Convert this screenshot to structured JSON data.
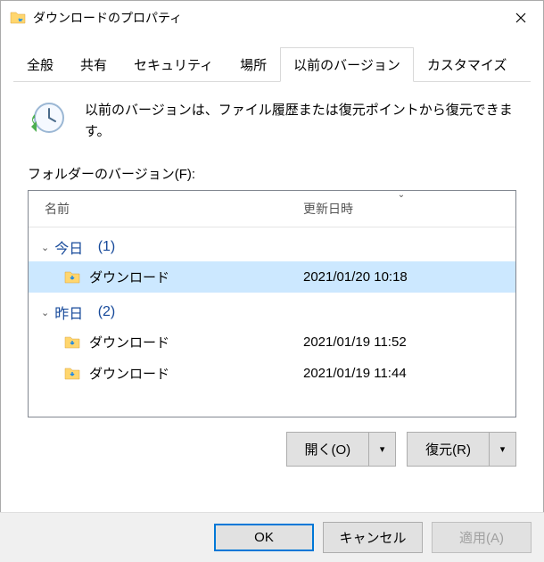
{
  "window": {
    "title": "ダウンロードのプロパティ"
  },
  "tabs": [
    {
      "label": "全般"
    },
    {
      "label": "共有"
    },
    {
      "label": "セキュリティ"
    },
    {
      "label": "場所"
    },
    {
      "label": "以前のバージョン",
      "active": true
    },
    {
      "label": "カスタマイズ"
    }
  ],
  "info_text": "以前のバージョンは、ファイル履歴または復元ポイントから復元できます。",
  "section_label": "フォルダーのバージョン(F):",
  "columns": {
    "name": "名前",
    "date": "更新日時"
  },
  "groups": [
    {
      "label": "今日",
      "count": "(1)",
      "items": [
        {
          "name": "ダウンロード",
          "date": "2021/01/20 10:18",
          "selected": true
        }
      ]
    },
    {
      "label": "昨日",
      "count": "(2)",
      "items": [
        {
          "name": "ダウンロード",
          "date": "2021/01/19 11:52",
          "selected": false
        },
        {
          "name": "ダウンロード",
          "date": "2021/01/19 11:44",
          "selected": false
        }
      ]
    }
  ],
  "actions": {
    "open": "開く(O)",
    "restore": "復元(R)"
  },
  "footer": {
    "ok": "OK",
    "cancel": "キャンセル",
    "apply": "適用(A)"
  }
}
